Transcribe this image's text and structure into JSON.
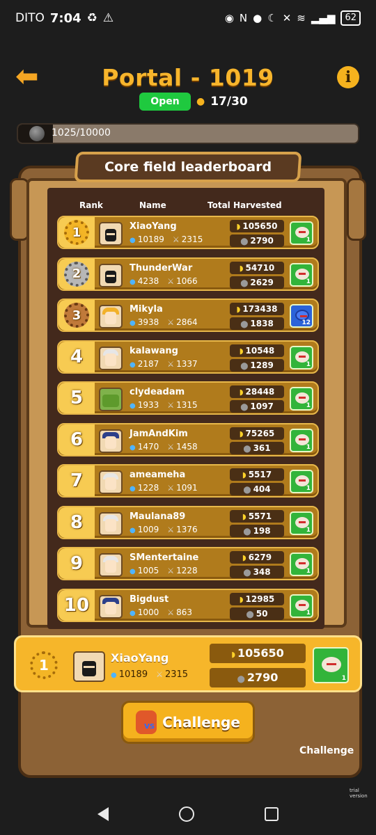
{
  "status_bar": {
    "carrier": "DITO",
    "time": "7:04",
    "battery": "62"
  },
  "header": {
    "title": "Portal - 1019",
    "status": "Open",
    "players": "17/30",
    "back_icon": "arrow-left-icon",
    "info_icon": "info-icon",
    "info_label": "i"
  },
  "progress": {
    "text": "1025/10000",
    "fraction": 0.1025
  },
  "board": {
    "title": "Core field leaderboard",
    "col_rank": "Rank",
    "col_name": "Name",
    "col_harvested": "Total Harvested"
  },
  "rows": [
    {
      "rank": "1",
      "name": "XiaoYang",
      "gems": "10189",
      "swords": "2315",
      "bananas": "105650",
      "stones": "2790",
      "pet_count": "1",
      "pet": "green"
    },
    {
      "rank": "2",
      "name": "ThunderWar",
      "gems": "4238",
      "swords": "1066",
      "bananas": "54710",
      "stones": "2629",
      "pet_count": "1",
      "pet": "green"
    },
    {
      "rank": "3",
      "name": "Mikyla",
      "gems": "3938",
      "swords": "2864",
      "bananas": "173438",
      "stones": "1838",
      "pet_count": "12",
      "pet": "blue"
    },
    {
      "rank": "4",
      "name": "kalawang",
      "gems": "2187",
      "swords": "1337",
      "bananas": "10548",
      "stones": "1289",
      "pet_count": "1",
      "pet": "green"
    },
    {
      "rank": "5",
      "name": "clydeadam",
      "gems": "1933",
      "swords": "1315",
      "bananas": "28448",
      "stones": "1097",
      "pet_count": "1",
      "pet": "green"
    },
    {
      "rank": "6",
      "name": "JamAndKim",
      "gems": "1470",
      "swords": "1458",
      "bananas": "75265",
      "stones": "361",
      "pet_count": "1",
      "pet": "green"
    },
    {
      "rank": "7",
      "name": "ameameha",
      "gems": "1228",
      "swords": "1091",
      "bananas": "5517",
      "stones": "404",
      "pet_count": "1",
      "pet": "green"
    },
    {
      "rank": "8",
      "name": "Maulana89",
      "gems": "1009",
      "swords": "1376",
      "bananas": "5571",
      "stones": "198",
      "pet_count": "1",
      "pet": "green"
    },
    {
      "rank": "9",
      "name": "SMentertaine",
      "gems": "1005",
      "swords": "1228",
      "bananas": "6279",
      "stones": "348",
      "pet_count": "1",
      "pet": "green"
    },
    {
      "rank": "10",
      "name": "Bigdust",
      "gems": "1000",
      "swords": "863",
      "bananas": "12985",
      "stones": "50",
      "pet_count": "1",
      "pet": "green"
    }
  ],
  "my_entry": {
    "rank": "1",
    "name": "XiaoYang",
    "gems": "10189",
    "swords": "2315",
    "bananas": "105650",
    "stones": "2790",
    "pet_count": "1"
  },
  "challenge": {
    "label": "Challenge",
    "behind_text": "Challenge"
  },
  "watermark": "trial version",
  "colors": {
    "title": "#f7b52c",
    "open_badge": "#1fc93f",
    "row_bg": "#b07b1c",
    "highlight": "#f6b62a"
  }
}
